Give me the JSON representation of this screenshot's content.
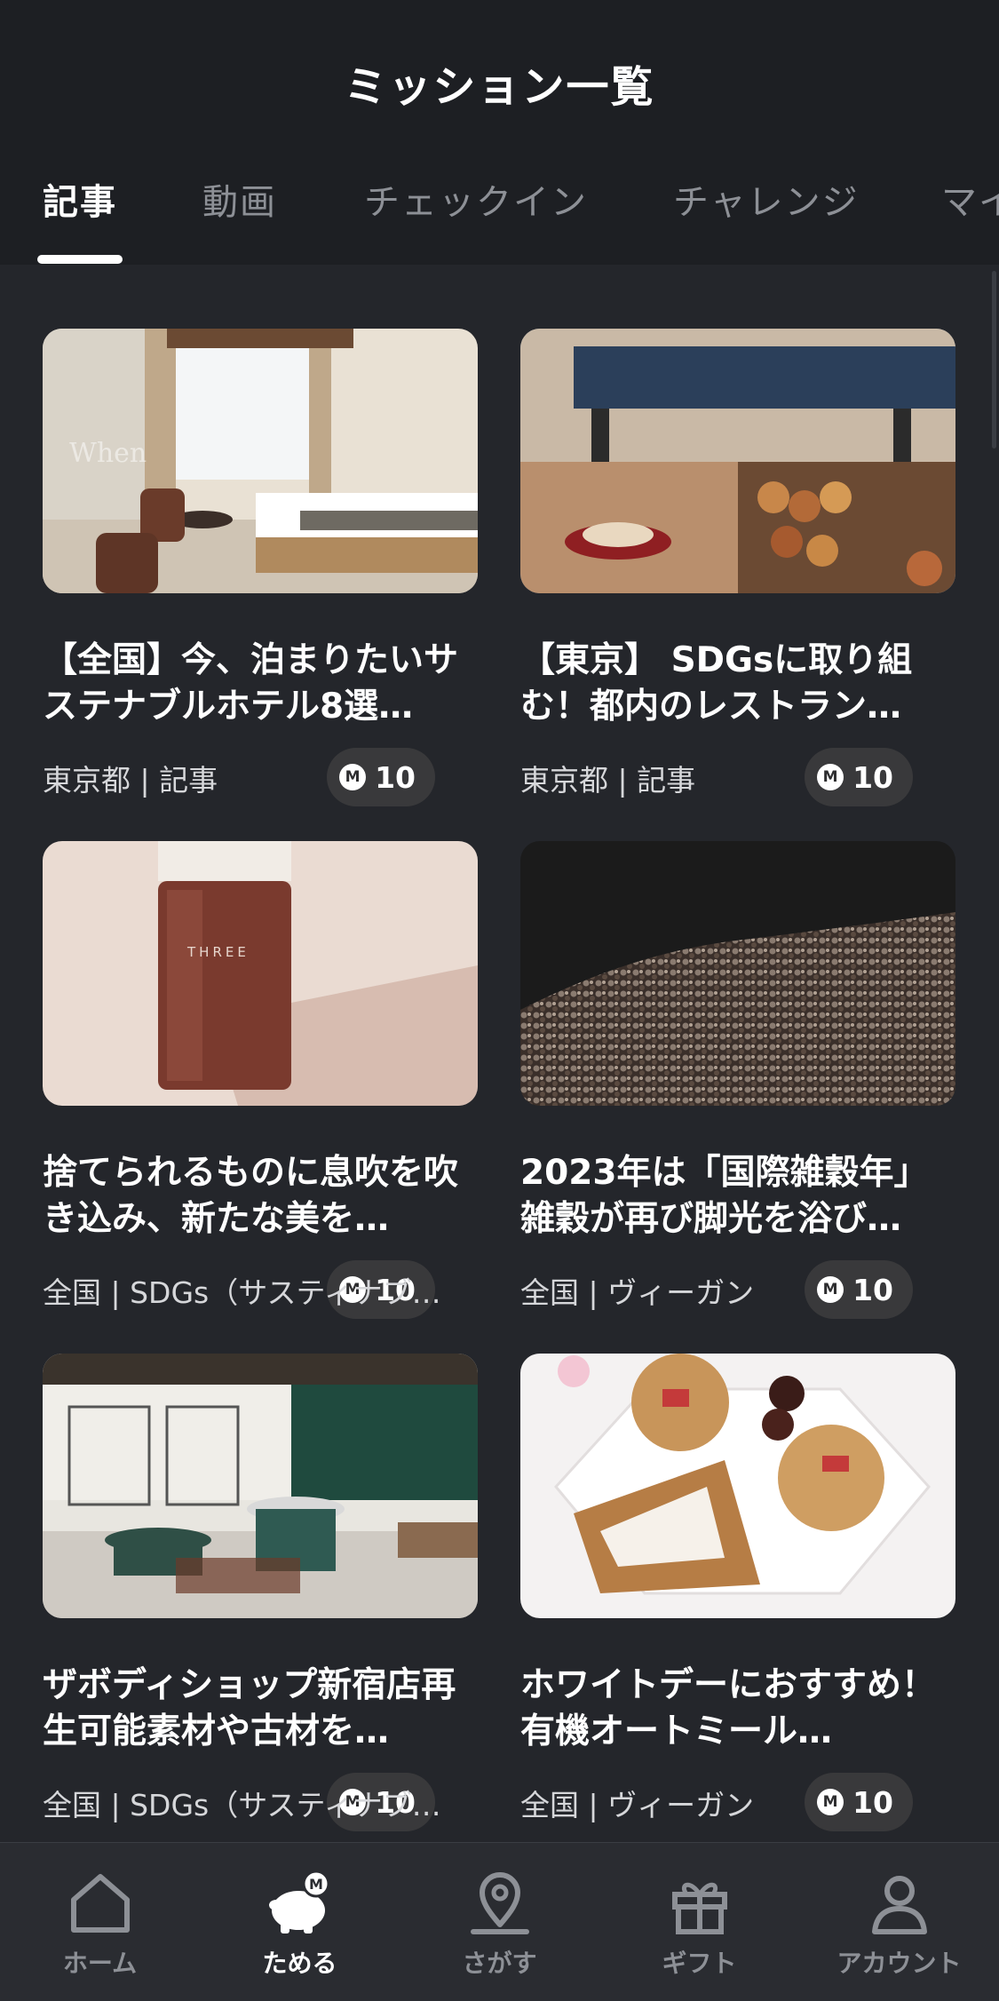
{
  "header": {
    "title": "ミッション一覧"
  },
  "tabs": [
    {
      "label": "記事",
      "active": true
    },
    {
      "label": "動画"
    },
    {
      "label": "チェックイン"
    },
    {
      "label": "チャレンジ"
    },
    {
      "label": "マイ"
    }
  ],
  "cards": [
    {
      "title": "【全国】今、泊まりたいサステナブルホテル8選…",
      "meta": "東京都 | 記事",
      "points": "10"
    },
    {
      "title": "【東京】 SDGsに取り組む！都内のレストラン…",
      "meta": "東京都 | 記事",
      "points": "10"
    },
    {
      "title": "捨てられるものに息吹を吹き込み、新たな美を…",
      "meta": "全国 | SDGs（サスティナブ…",
      "points": "10"
    },
    {
      "title": "2023年は「国際雑穀年」雑穀が再び脚光を浴び…",
      "meta": "全国 | ヴィーガン",
      "points": "10"
    },
    {
      "title": "ザボディショップ新宿店再生可能素材や古材を…",
      "meta": "全国 | SDGs（サスティナブ…",
      "points": "10"
    },
    {
      "title": "ホワイトデーにおすすめ！有機オートミール…",
      "meta": "全国 | ヴィーガン",
      "points": "10"
    }
  ],
  "coin_symbol": "M",
  "nav": [
    {
      "label": "ホーム",
      "icon": "home-icon"
    },
    {
      "label": "ためる",
      "icon": "piggy-bank-icon",
      "active": true
    },
    {
      "label": "さがす",
      "icon": "location-pin-icon"
    },
    {
      "label": "ギフト",
      "icon": "gift-icon"
    },
    {
      "label": "アカウント",
      "icon": "person-icon"
    }
  ],
  "colors": {
    "background": "#24262b",
    "header": "#1d1f23",
    "inactive": "#8d9096"
  }
}
